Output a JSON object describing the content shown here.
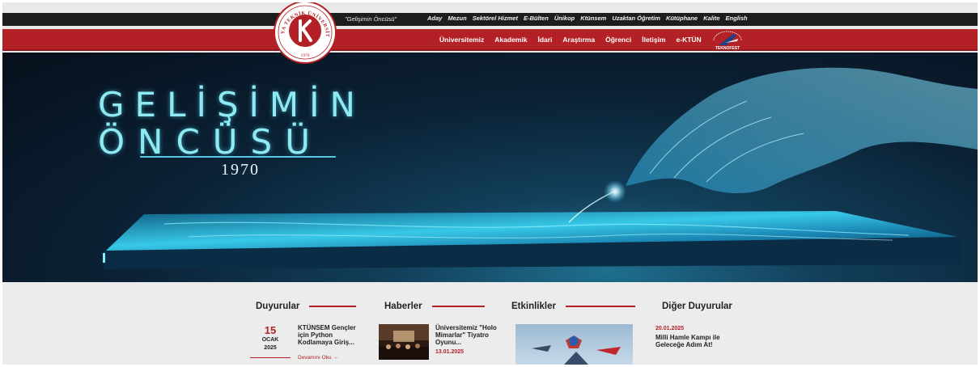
{
  "header": {
    "slogan": "\"Gelişimin Öncüsü\"",
    "top_links": [
      "Aday",
      "Mezun",
      "Sektörel Hizmet",
      "E-Bülten",
      "Ünikop",
      "Ktünsem",
      "Uzaktan Öğretim",
      "Kütüphane",
      "Kalite",
      "English"
    ],
    "main_nav": [
      "Üniversitemiz",
      "Akademik",
      "İdari",
      "Araştırma",
      "Öğrenci",
      "İletişim",
      "e-KTÜN"
    ],
    "logo": {
      "ring_text": "KONYA TEKNİK ÜNİVERSİTESİ",
      "year": "1970",
      "icon": "ktun-logo-icon"
    },
    "teknofest_icon": "teknofest-logo-icon",
    "teknofest_text": "TEKNOFEST"
  },
  "hero": {
    "title_line1": "GELİŞİMİN",
    "title_line2": "ÖNCÜSÜ",
    "year": "1970"
  },
  "sections": {
    "duyurular": {
      "heading": "Duyurular",
      "item": {
        "day": "15",
        "month": "OCAK",
        "year": "2025",
        "title": "KTÜNSEM Gençler için Python Kodlamaya Giriş...",
        "more": "Devamını Oku →"
      }
    },
    "haberler": {
      "heading": "Haberler",
      "item": {
        "title": "Üniversitemiz \"Holo Mimarlar\" Tiyatro Oyunu...",
        "date": "13.01.2025"
      }
    },
    "etkinlikler": {
      "heading": "Etkinlikler"
    },
    "diger": {
      "heading": "Diğer Duyurular",
      "item": {
        "date": "20.01.2025",
        "title": "Milli Hamle Kampı ile Geleceğe Adım At!"
      }
    }
  },
  "colors": {
    "brand_red": "#b32025",
    "top_bar": "#1d1d1f",
    "hero_cyan": "#8fe9f3"
  }
}
